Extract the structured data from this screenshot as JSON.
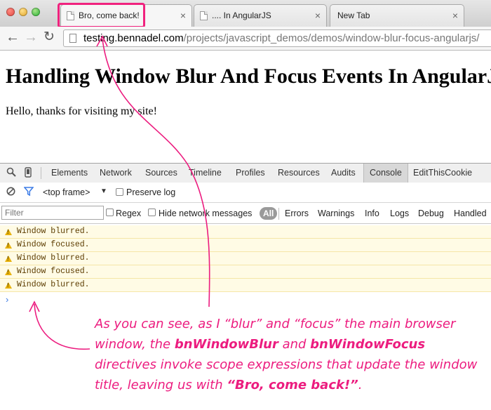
{
  "browser": {
    "tabs": [
      {
        "title": "Bro, come back!",
        "active": true
      },
      {
        "title": ".... In AngularJS",
        "active": false
      },
      {
        "title": "New Tab",
        "active": false
      }
    ],
    "close_glyph": "×",
    "address": {
      "host": "testing.bennadel.com",
      "path": "/projects/javascript_demos/demos/window-blur-focus-angularjs/"
    }
  },
  "page": {
    "heading": "Handling Window Blur And Focus Events In AngularJS",
    "text": "Hello, thanks for visiting my site!"
  },
  "devtools": {
    "tabs": [
      "Elements",
      "Network",
      "Sources",
      "Timeline",
      "Profiles",
      "Resources",
      "Audits",
      "Console",
      "EditThisCookie"
    ],
    "selected_tab": "Console",
    "context": "<top frame>",
    "preserve_log": "Preserve log",
    "filter_placeholder": "Filter",
    "regex": "Regex",
    "hide_network": "Hide network messages",
    "levels": [
      "All",
      "Errors",
      "Warnings",
      "Info",
      "Logs",
      "Debug",
      "Handled"
    ],
    "messages": [
      "Window blurred.",
      "Window focused.",
      "Window blurred.",
      "Window focused.",
      "Window blurred."
    ],
    "prompt": "›"
  },
  "annotation": {
    "line1": "As you can see, as I “blur” and “focus” the main browser",
    "line2a": "window, the ",
    "line2b": "bnWindowBlur",
    "line2c": " and ",
    "line2d": "bnWindowFocus",
    "line3": "directives invoke scope expressions that update the window",
    "line4a": "title, leaving us with ",
    "line4b": "“Bro, come back!”",
    "line4c": ".",
    "color": "#ec1c7f"
  }
}
